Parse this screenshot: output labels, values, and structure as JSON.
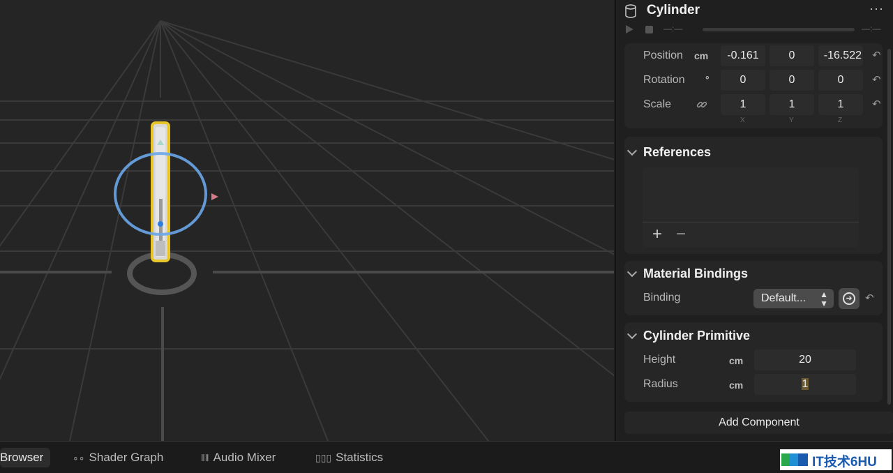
{
  "inspector": {
    "title": "Cylinder",
    "object_icon": "cylinder-icon",
    "more_icon": "ellipsis-icon",
    "timeline": {
      "start_time": "—:—",
      "end_time": "—:—"
    },
    "transform": {
      "position": {
        "label": "Position",
        "unit": "cm",
        "x": "-0.161",
        "y": "0",
        "z": "-16.522"
      },
      "rotation": {
        "label": "Rotation",
        "unit": "°",
        "x": "0",
        "y": "0",
        "z": "0"
      },
      "scale": {
        "label": "Scale",
        "unit_icon": "link-icon",
        "x": "1",
        "y": "1",
        "z": "1"
      },
      "axes": [
        "X",
        "Y",
        "Z"
      ]
    },
    "references": {
      "title": "References",
      "add": "+",
      "remove": "−"
    },
    "material_bindings": {
      "title": "Material Bindings",
      "binding_label": "Binding",
      "binding_value": "Default..."
    },
    "cylinder_primitive": {
      "title": "Cylinder Primitive",
      "height": {
        "label": "Height",
        "unit": "cm",
        "value": "20"
      },
      "radius": {
        "label": "Radius",
        "unit": "cm",
        "value": "1"
      }
    },
    "add_component": "Add Component",
    "reset_icon": "↶"
  },
  "tabs": [
    {
      "label": "Browser",
      "icon": "",
      "active": true
    },
    {
      "label": "Shader Graph",
      "icon": "node-graph-icon",
      "active": false
    },
    {
      "label": "Audio Mixer",
      "icon": "sliders-icon",
      "active": false
    },
    {
      "label": "Statistics",
      "icon": "bar-chart-icon",
      "active": false
    }
  ],
  "watermark": {
    "text": "IT技术6HU"
  },
  "colors": {
    "selection": "#e8c62a",
    "gizmo_ring": "#6aa6e8",
    "background": "#252525"
  }
}
